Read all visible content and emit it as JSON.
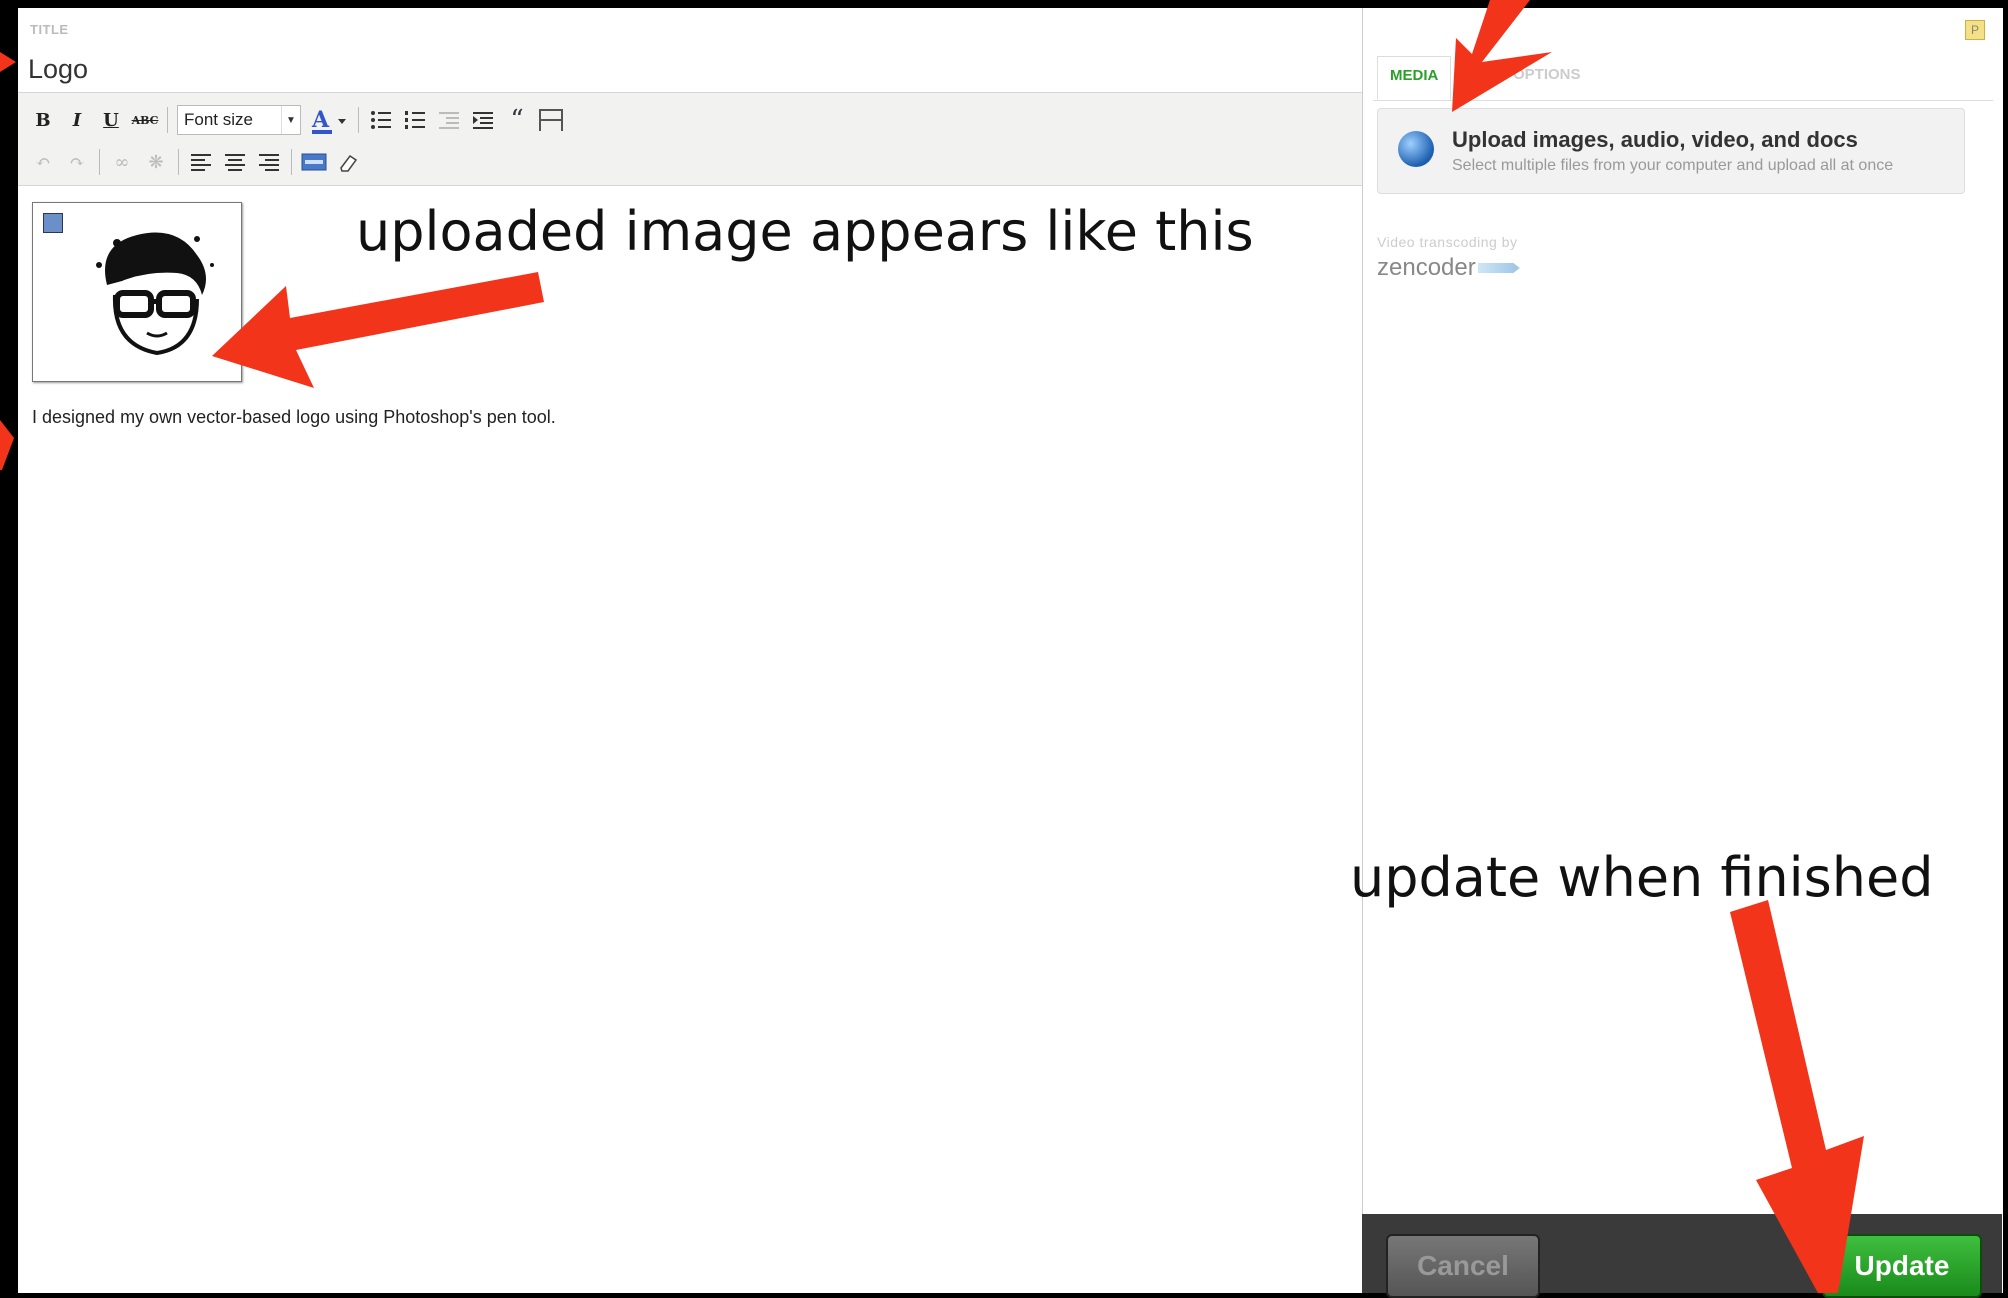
{
  "editor": {
    "title_label": "TITLE",
    "title_value": "Logo",
    "toolbar": {
      "row1": [
        {
          "name": "bold-button",
          "glyph": "B"
        },
        {
          "name": "italic-button",
          "glyph": "I"
        },
        {
          "name": "underline-button",
          "glyph": "U"
        },
        {
          "name": "strikethrough-button",
          "glyph": "ABC"
        }
      ],
      "font_size_label": "Font size"
    },
    "body_text": "I designed my own vector-based logo using Photoshop's pen tool."
  },
  "sidebar": {
    "badge": "P",
    "tabs": {
      "media": "MEDIA",
      "options": "OPTIONS"
    },
    "upload": {
      "title": "Upload images, audio, video, and docs",
      "subtitle": "Select multiple files from your computer and upload all at once"
    },
    "transcode_label": "Video transcoding by",
    "transcode_brand": "zencoder",
    "buttons": {
      "cancel": "Cancel",
      "update": "Update"
    }
  },
  "annotations": {
    "image_note": "uploaded image appears like this",
    "update_note": "update when finished"
  },
  "colors": {
    "accent_green": "#2aa02a",
    "arrow_red": "#f2341a",
    "update_green": "#1a8a1a"
  }
}
